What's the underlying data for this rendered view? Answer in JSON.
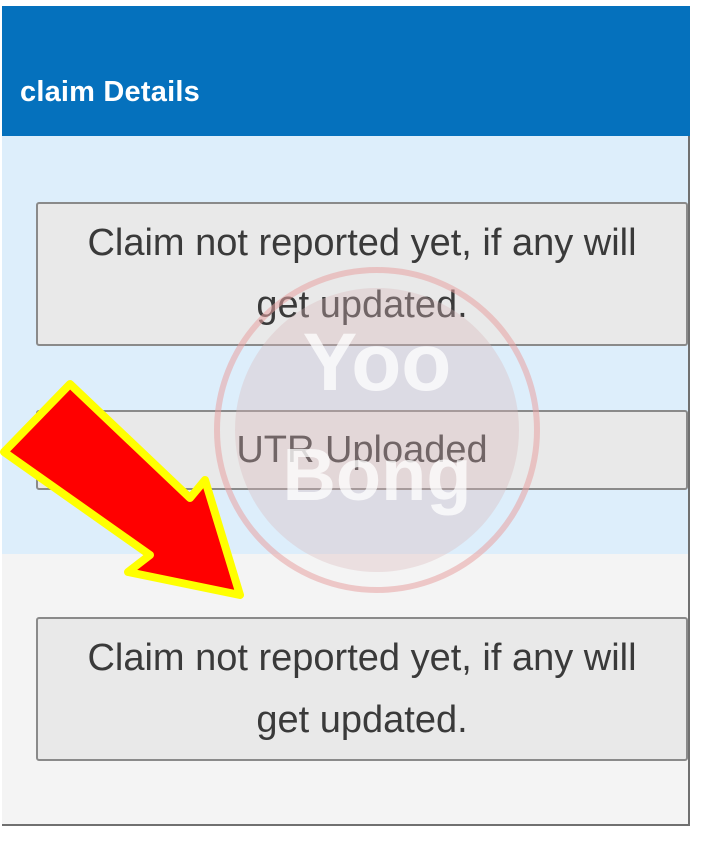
{
  "header": {
    "title": "claim Details"
  },
  "statuses": [
    {
      "text": "Claim not reported yet, if any will get updated."
    },
    {
      "text": "UTR Uploaded"
    },
    {
      "text": "Claim not reported yet, if any will get updated."
    }
  ],
  "watermark": {
    "text_top": "Yoo",
    "text_bottom": "Bong"
  },
  "colors": {
    "header": "#0571bd",
    "panel_blue": "#ddeefb",
    "arrow_fill": "#ff0000",
    "arrow_outline": "#ffff00"
  },
  "icons": {
    "annotation": "red-arrow-icon",
    "watermark": "yoobong-logo"
  }
}
